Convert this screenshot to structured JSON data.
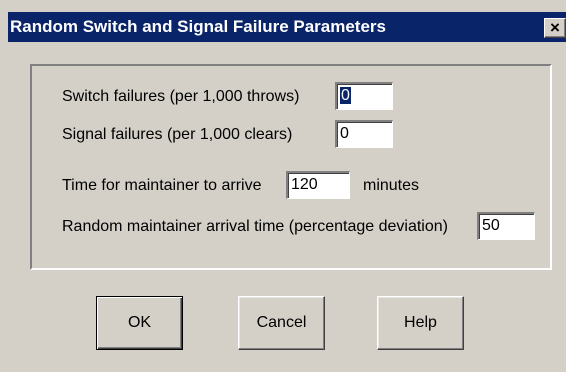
{
  "window": {
    "title": "Random Switch and Signal Failure Parameters",
    "close_glyph": "×"
  },
  "fields": {
    "switch_failures": {
      "label": "Switch failures (per 1,000 throws)",
      "value": "0"
    },
    "signal_failures": {
      "label": "Signal failures (per 1,000 clears)",
      "value": "0"
    },
    "maintainer_time": {
      "label": "Time for maintainer to arrive",
      "value": "120",
      "unit": "minutes"
    },
    "arrival_deviation": {
      "label": "Random maintainer arrival time (percentage deviation)",
      "value": "50"
    }
  },
  "buttons": {
    "ok": "OK",
    "cancel": "Cancel",
    "help": "Help"
  }
}
